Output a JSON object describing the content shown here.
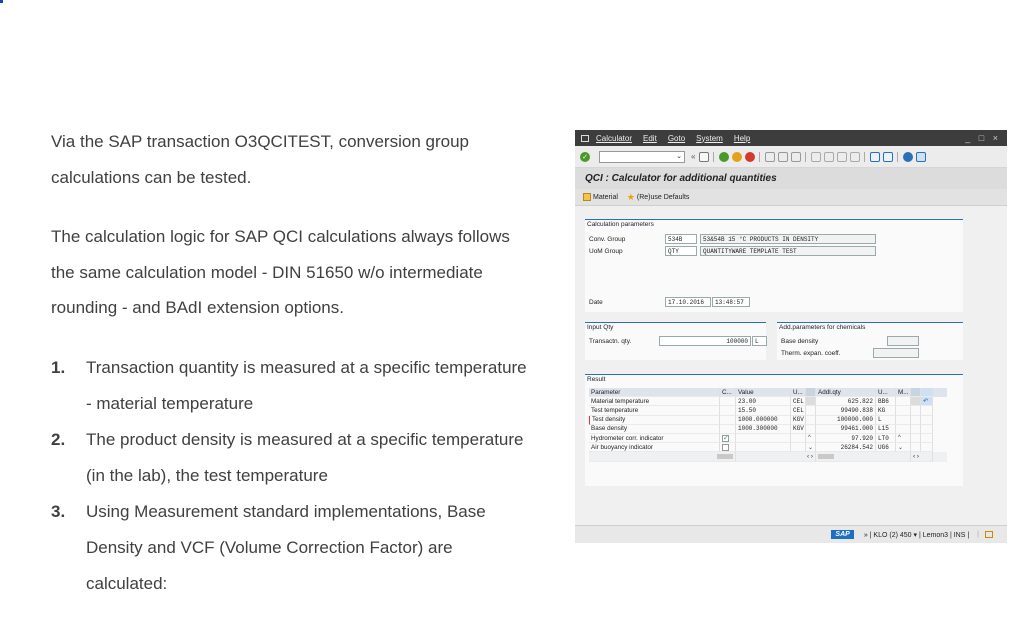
{
  "slide": {
    "para1": [
      "Via the SAP transaction O3QCITEST, conversion group",
      "calculations can be tested."
    ],
    "para2": [
      "The calculation logic for SAP QCI calculations always follows",
      "the same calculation model - DIN 51650 w/o intermediate",
      "rounding - and BAdI extension options."
    ],
    "steps": [
      {
        "num": "1.",
        "lines": [
          "Transaction quantity is measured at a specific temperature",
          "- material temperature"
        ]
      },
      {
        "num": "2.",
        "lines": [
          "The product density is measured at a specific temperature",
          "(in the lab), the test temperature"
        ]
      },
      {
        "num": "3.",
        "lines": [
          "Using Measurement standard implementations, Base",
          "Density and VCF (Volume Correction Factor) are",
          "calculated:"
        ]
      }
    ]
  },
  "sap": {
    "menu": [
      "Calculator",
      "Edit",
      "Goto",
      "System",
      "Help"
    ],
    "window_controls": "_ □ ×",
    "title": "QCI : Calculator for additional quantities",
    "app_buttons": [
      "Material",
      "(Re)use Defaults"
    ],
    "calc_params": {
      "title": "Calculation parameters",
      "conv_group_label": "Conv. Group",
      "conv_group_value": "534B",
      "conv_group_desc": "53&54B 15 °C PRODUCTS  IN DENSITY",
      "uom_group_label": "UoM Group",
      "uom_group_value": "QTY",
      "uom_group_desc": "QUANTITYWARE TEMPLATE TEST",
      "date_label": "Date",
      "date_value": "17.10.2016",
      "time_value": "13:48:57"
    },
    "input_qty": {
      "title": "Input Qty",
      "label": "Transactn. qty.",
      "value": "100000",
      "unit": "L"
    },
    "add_params": {
      "title": "Add.parameters for chemicals",
      "base_density_label": "Base density",
      "therm_label": "Therm. expan. coeff."
    },
    "result": {
      "title": "Result",
      "headers": [
        "Parameter",
        "C...",
        "Value",
        "U...",
        "Addl.qty",
        "U...",
        "M..."
      ],
      "rows": [
        {
          "param": "Material temperature",
          "value": "23.00",
          "unit": "CEL",
          "addl": "625.822",
          "aunit": "BB6"
        },
        {
          "param": "Test temperature",
          "value": "15.50",
          "unit": "CEL",
          "addl": "99490.838",
          "aunit": "KG"
        },
        {
          "param": "Test density",
          "value": "1000.000000",
          "unit": "KGV",
          "addl": "100000.000",
          "aunit": "L"
        },
        {
          "param": "Base density",
          "value": "1000.300000",
          "unit": "KGV",
          "addl": "99461.000",
          "aunit": "L15"
        },
        {
          "param": "Hydrometer corr. indicator",
          "value": "",
          "unit": "",
          "addl": "97.920",
          "aunit": "LT0"
        },
        {
          "param": "Air buoyancy indicator",
          "value": "",
          "unit": "",
          "addl": "26284.542",
          "aunit": "UG6"
        }
      ]
    },
    "status": {
      "logo": "SAP",
      "text": "» | KLO (2) 450 ▾ | Lemon3 | INS |"
    },
    "colors": {
      "menubar": "#3d3d3d",
      "group_line": "#2a70b8",
      "sap_blue": "#1d6fc4"
    }
  }
}
